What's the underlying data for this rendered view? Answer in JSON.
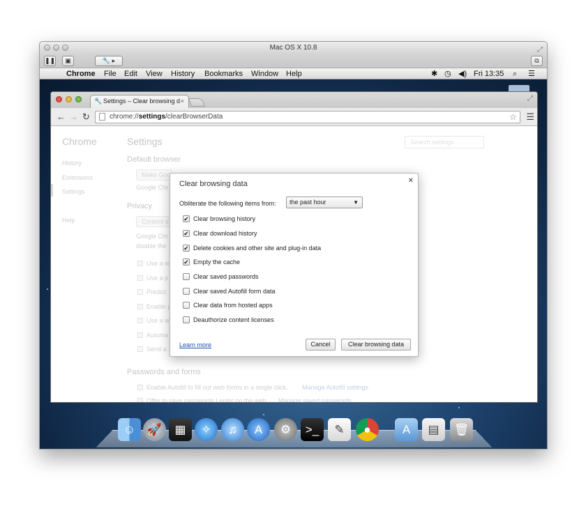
{
  "vm": {
    "title": "Mac OS X 10.8"
  },
  "menubar": {
    "apple": "",
    "items": [
      "Chrome",
      "File",
      "Edit",
      "View",
      "History",
      "Bookmarks",
      "Window",
      "Help"
    ],
    "clock": "Fri 13:35"
  },
  "browser": {
    "tab_title": "Settings – Clear browsing d",
    "url_scheme": "chrome://",
    "url_bold": "settings",
    "url_rest": "/clearBrowserData"
  },
  "settings": {
    "brand": "Chrome",
    "sidebar": [
      "History",
      "Extensions",
      "Settings",
      "Help"
    ],
    "title": "Settings",
    "search_placeholder": "Search settings",
    "default_browser_heading": "Default browser",
    "make_default_btn": "Make Goo",
    "google_chrome_note": "Google Chr",
    "privacy_heading": "Privacy",
    "content_settings_btn": "Content s",
    "privacy_note1": "Google Chr",
    "privacy_note2": "disable the",
    "privacy_items": [
      "Use a w",
      "Use a p",
      "Predict",
      "Enable p",
      "Use a w",
      "Automa",
      "Send a"
    ],
    "passwords_heading": "Passwords and forms",
    "autofill_text": "Enable Autofill to fill out web forms in a single click.",
    "autofill_link": "Manage Autofill settings",
    "offer_text": "Offer to save passwords I enter on the web.",
    "offer_link": "Manage saved passwords"
  },
  "dialog": {
    "title": "Clear browsing data",
    "close": "×",
    "obliterate_label": "Obliterate the following items from:",
    "period": "the past hour",
    "options": [
      {
        "label": "Clear browsing history",
        "checked": true
      },
      {
        "label": "Clear download history",
        "checked": true
      },
      {
        "label": "Delete cookies and other site and plug-in data",
        "checked": true
      },
      {
        "label": "Empty the cache",
        "checked": true
      },
      {
        "label": "Clear saved passwords",
        "checked": false
      },
      {
        "label": "Clear saved Autofill form data",
        "checked": false
      },
      {
        "label": "Clear data from hosted apps",
        "checked": false
      },
      {
        "label": "Deauthorize content licenses",
        "checked": false
      }
    ],
    "learn_more": "Learn more",
    "cancel": "Cancel",
    "clear": "Clear browsing data",
    "checkmark": "✔"
  },
  "dock": {
    "icons": [
      "finder-icon",
      "launchpad-icon",
      "photo-booth-icon",
      "safari-icon",
      "itunes-icon",
      "app-store-icon",
      "system-preferences-icon",
      "terminal-icon",
      "textedit-icon",
      "chrome-icon",
      "applications-folder-icon",
      "downloads-stack-icon",
      "trash-icon"
    ]
  }
}
